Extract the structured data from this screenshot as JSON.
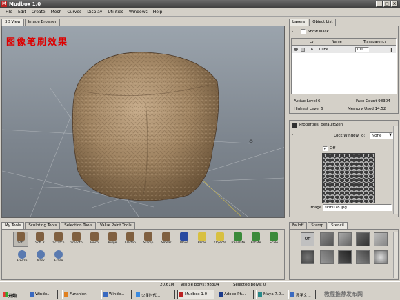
{
  "window": {
    "title": "Mudbox 1.0",
    "app_icon": "M"
  },
  "menu": [
    "File",
    "Edit",
    "Create",
    "Mesh",
    "Curves",
    "Display",
    "Utilities",
    "Windows",
    "Help"
  ],
  "view_tabs": [
    "3D View",
    "Image Browser"
  ],
  "overlay_text": "图像笔刷效果",
  "layers_panel": {
    "tabs": [
      "Layers",
      "Object List"
    ],
    "show_mask_label": "Show Mask",
    "columns": [
      "",
      "",
      "Lvl",
      "Name",
      "Transparency"
    ],
    "row": {
      "level": "6",
      "name": "Cube",
      "transparency": "100"
    },
    "stats": {
      "active_level": "Active Level 6",
      "face_count": "Face Count 98304",
      "highest_level": "Highest Level 6",
      "memory_used": "Memory Used 14.52"
    }
  },
  "properties_panel": {
    "title": "Properties: defaultSten",
    "lock_window_label": "Lock Window To:",
    "lock_window_value": "None",
    "off_label": "Off",
    "image_label": "Image",
    "image_value": "skin078.jpg"
  },
  "tools_panel": {
    "tabs": [
      "My Tools",
      "Sculpting Tools",
      "Selection Tools",
      "Value Paint Tools"
    ],
    "tools": [
      "Soft",
      "Soft R",
      "Scratch",
      "Smooth",
      "Pinch",
      "Bulge",
      "Flatten",
      "Stamp",
      "Smear",
      "Move",
      "Faces",
      "Objects",
      "Translate",
      "Rotate",
      "Scale"
    ],
    "tools_row2": [
      "Freeze",
      "Mask",
      "Erase"
    ]
  },
  "stencil_panel": {
    "tabs": [
      "Falloff",
      "Stamp",
      "Stencil"
    ],
    "off_label": "Off"
  },
  "status": {
    "memory": "20.61M",
    "visible_polys": "Visible polys: 98304",
    "selected_polys": "Selected polys: 0"
  },
  "taskbar": {
    "start": "开始",
    "items": [
      "Windo...",
      "Funshion",
      "Windo...",
      "火星时代...",
      "Mudbox 1.0",
      "Adobe Ph...",
      "Maya 7.0...",
      "教学文..."
    ],
    "tray_text": "教程推荐发布网"
  }
}
